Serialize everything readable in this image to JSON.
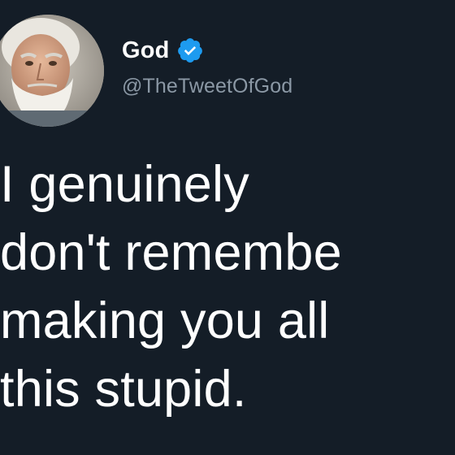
{
  "author": {
    "display_name": "God",
    "handle": "@TheTweetOfGod",
    "verified": true,
    "avatar_icon": "bearded-man-avatar"
  },
  "tweet": {
    "lines": [
      "I genuinely",
      "don't remembe",
      "making you all",
      "this stupid."
    ]
  },
  "colors": {
    "background": "#141d27",
    "text": "#ffffff",
    "handle": "#8b98a5",
    "verified_badge": "#1d9bf0"
  }
}
